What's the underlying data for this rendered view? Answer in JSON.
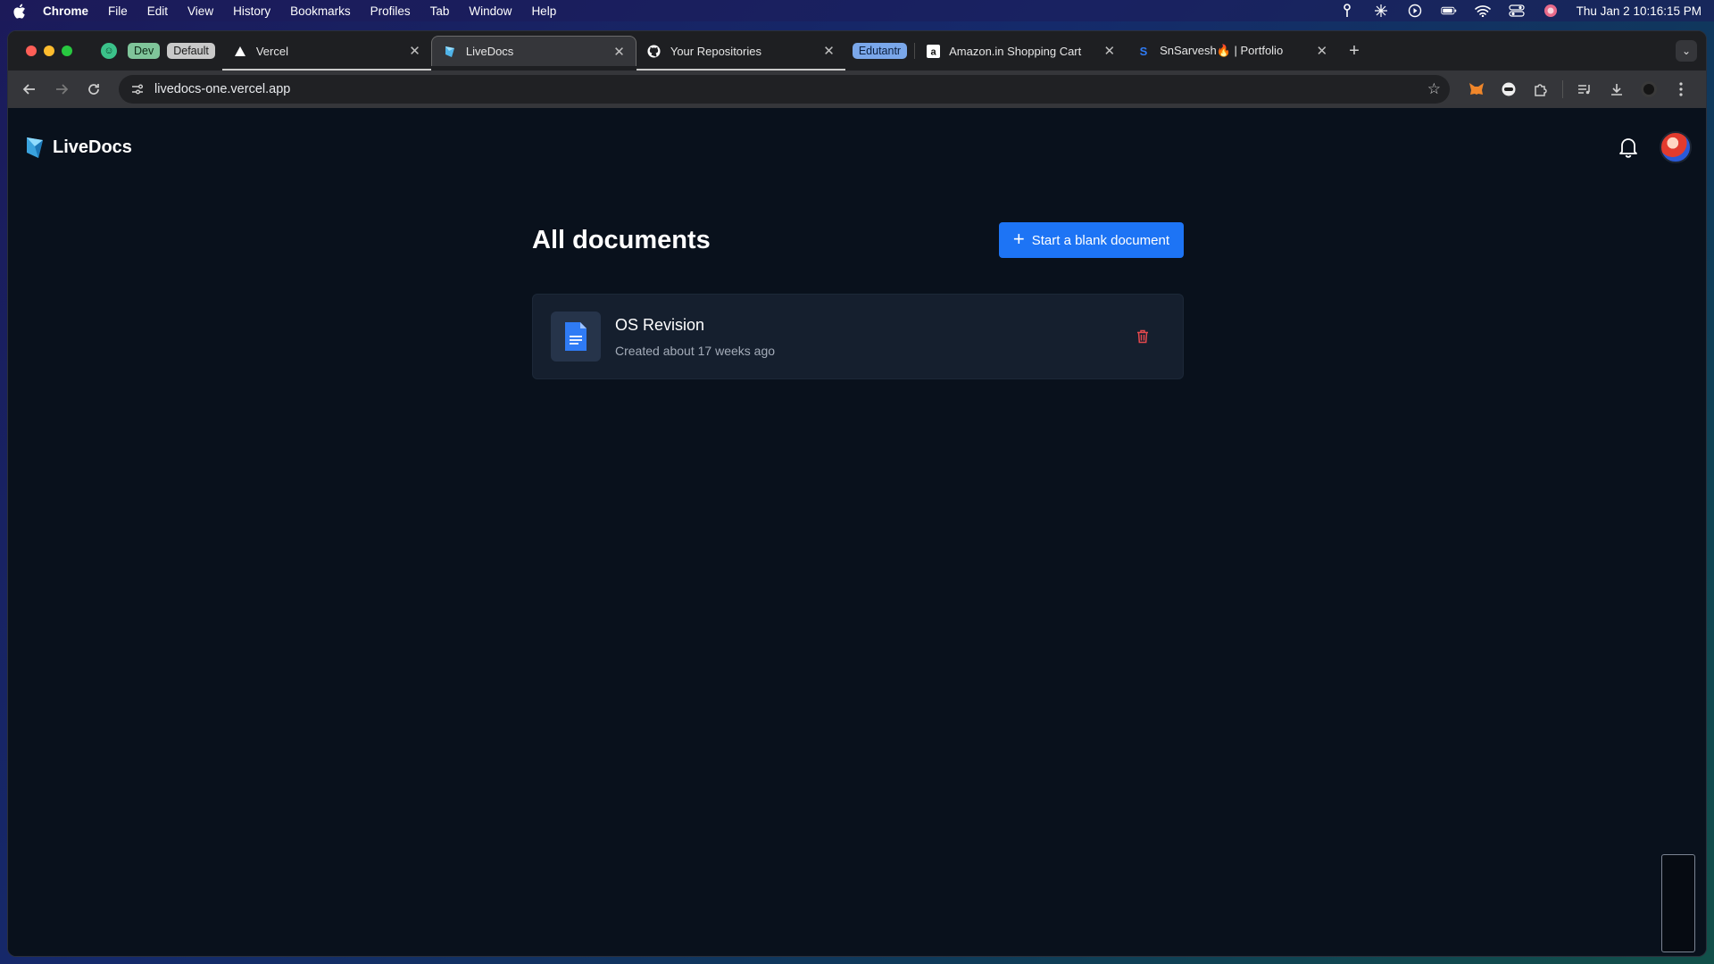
{
  "menubar": {
    "app_name": "Chrome",
    "items": [
      "File",
      "Edit",
      "View",
      "History",
      "Bookmarks",
      "Profiles",
      "Tab",
      "Window",
      "Help"
    ],
    "clock": "Thu Jan 2  10:16:15 PM"
  },
  "tabstrip": {
    "group_dev": "Dev",
    "group_default": "Default",
    "group_edu": "Edutantr",
    "tabs": [
      {
        "title": "Vercel",
        "icon": "vercel-triangle-icon"
      },
      {
        "title": "LiveDocs",
        "icon": "livedocs-icon",
        "active": true
      },
      {
        "title": "Your Repositories",
        "icon": "github-icon"
      },
      {
        "title": "Amazon.in Shopping Cart",
        "icon": "amazon-icon"
      },
      {
        "title": "SnSarvesh🔥 | Portfolio",
        "icon": "s-logo-icon"
      }
    ]
  },
  "toolbar": {
    "url": "livedocs-one.vercel.app"
  },
  "app": {
    "brand": "LiveDocs",
    "page_title": "All documents",
    "new_doc_button": "Start a blank document",
    "documents": [
      {
        "title": "OS Revision",
        "meta": "Created about 17 weeks ago"
      }
    ]
  },
  "colors": {
    "accent": "#1d74f5",
    "delete": "#e5484d",
    "background": "#09111c",
    "card": "#151f2e"
  }
}
